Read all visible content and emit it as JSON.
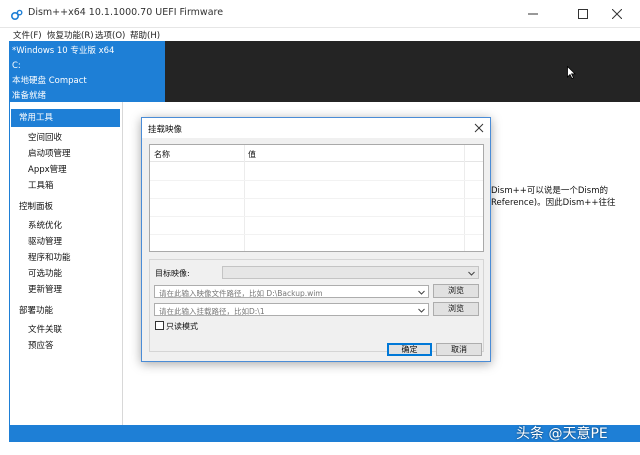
{
  "window": {
    "title": "Dism++x64 10.1.1000.70 UEFI Firmware",
    "controls": {
      "minimize": "—",
      "maximize": "☐",
      "close": "✕"
    }
  },
  "menubar": {
    "items": [
      "文件(F)",
      "恢复功能(R)",
      "选项(O)",
      "帮助(H)"
    ]
  },
  "system_info": {
    "lines": [
      "*Windows 10 专业版 x64",
      "C:",
      "本地硬盘 Compact",
      "准备就绪"
    ]
  },
  "sidebar": {
    "active": "常用工具",
    "groups": [
      {
        "label": "常用工具",
        "items": [
          "空间回收",
          "启动项管理",
          "Appx管理",
          "工具箱"
        ]
      },
      {
        "label": "控制面板",
        "items": [
          "系统优化",
          "驱动管理",
          "程序和功能",
          "可选功能",
          "更新管理"
        ]
      },
      {
        "label": "部署功能",
        "items": [
          "文件关联",
          "预应答"
        ]
      }
    ]
  },
  "main": {
    "text_lines": [
      "Dism++可以说是一个Dism的",
      "Reference)。因此Dism++往往"
    ]
  },
  "dialog": {
    "title": "挂载映像",
    "close_icon": "close-icon",
    "list_columns": [
      "名称",
      "值"
    ],
    "target_image_label": "目标映像:",
    "target_image_value": "",
    "image_path_placeholder": "请在此输入映像文件路径，比如 D:\\Backup.wim",
    "mount_path_placeholder": "请在此输入挂载路径，比如D:\\1",
    "browse_label": "浏览",
    "readonly_label": "只读模式",
    "readonly_checked": false,
    "ok_label": "确定",
    "cancel_label": "取消"
  },
  "watermark": "头条 @天意PE",
  "colors": {
    "accent": "#1e7fd6",
    "dark_panel": "#242424",
    "dialog_bg": "#f0f0f0"
  }
}
